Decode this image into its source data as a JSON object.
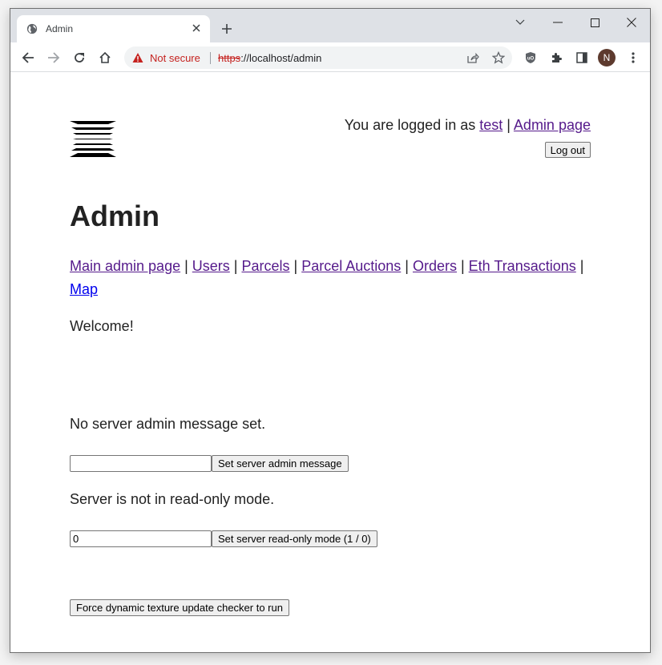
{
  "browser": {
    "tab_title": "Admin",
    "url_scheme": "https",
    "url_rest": "://localhost/admin",
    "security_label": "Not secure",
    "profile_initial": "N"
  },
  "header": {
    "logged_in_prefix": "You are logged in as ",
    "username": "test",
    "separator": " | ",
    "admin_link": "Admin page",
    "logout_label": "Log out"
  },
  "main": {
    "title": "Admin",
    "nav": [
      {
        "label": "Main admin page",
        "visited": true
      },
      {
        "label": "Users",
        "visited": true
      },
      {
        "label": "Parcels",
        "visited": true
      },
      {
        "label": "Parcel Auctions",
        "visited": true
      },
      {
        "label": "Orders",
        "visited": true
      },
      {
        "label": "Eth Transactions",
        "visited": true
      },
      {
        "label": "Map",
        "visited": false
      }
    ],
    "nav_separator": " | ",
    "welcome": "Welcome!",
    "admin_message_status": "No server admin message set.",
    "admin_message_value": "",
    "set_admin_message_label": "Set server admin message",
    "read_only_status": "Server is not in read-only mode.",
    "read_only_value": "0",
    "set_read_only_label": "Set server read-only mode (1 / 0)",
    "force_texture_label": "Force dynamic texture update checker to run"
  }
}
